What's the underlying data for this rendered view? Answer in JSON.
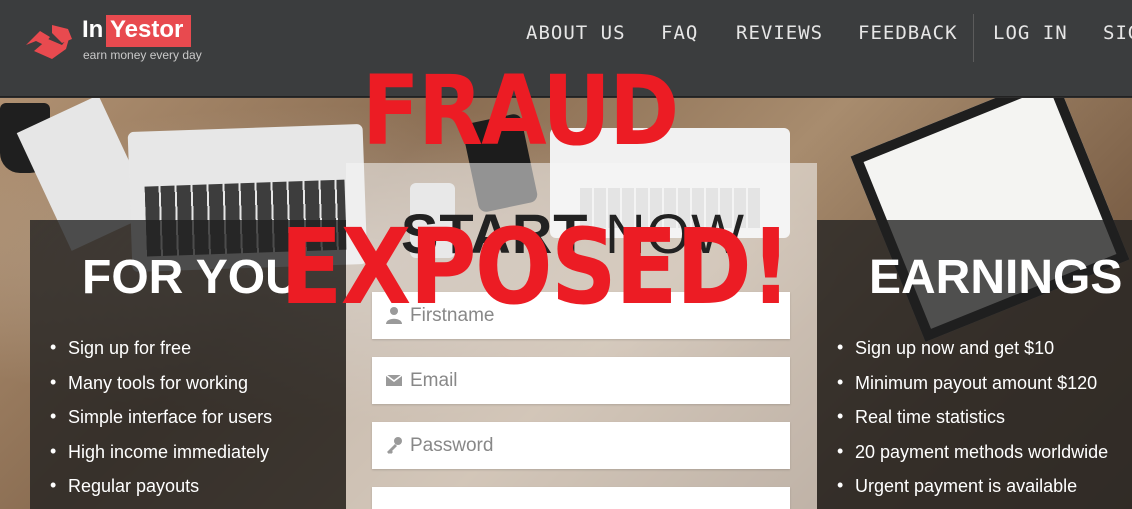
{
  "brand": {
    "name_prefix": "In",
    "name_highlight": "Yestor",
    "tagline": "earn money every day",
    "accent_color": "#e84a4f"
  },
  "nav": {
    "items": [
      {
        "label": "ABOUT US"
      },
      {
        "label": "FAQ"
      },
      {
        "label": "REVIEWS"
      },
      {
        "label": "FEEDBACK"
      },
      {
        "label": "LOG IN"
      },
      {
        "label": "SIG"
      }
    ]
  },
  "left_panel": {
    "title": "FOR YOU",
    "items": [
      {
        "label": "Sign up for free"
      },
      {
        "label": "Many tools for working"
      },
      {
        "label": "Simple interface for users"
      },
      {
        "label": "High income immediately"
      },
      {
        "label": "Regular payouts"
      }
    ]
  },
  "right_panel": {
    "title": "EARNINGS",
    "items": [
      {
        "label": "Sign up now and get $10"
      },
      {
        "label": "Minimum payout amount $120"
      },
      {
        "label": "Real time statistics"
      },
      {
        "label": "20 payment methods worldwide"
      },
      {
        "label": "Urgent payment is available"
      }
    ]
  },
  "form": {
    "title_bold": "START",
    "title_light": "NOW",
    "fields": [
      {
        "placeholder": "Firstname",
        "icon": "user-icon"
      },
      {
        "placeholder": "Email",
        "icon": "envelope-icon"
      },
      {
        "placeholder": "Password",
        "icon": "key-icon"
      }
    ]
  },
  "overlay": {
    "line1": "FRAUD",
    "line2": "EXPOSED!",
    "color": "#ec1c24"
  }
}
